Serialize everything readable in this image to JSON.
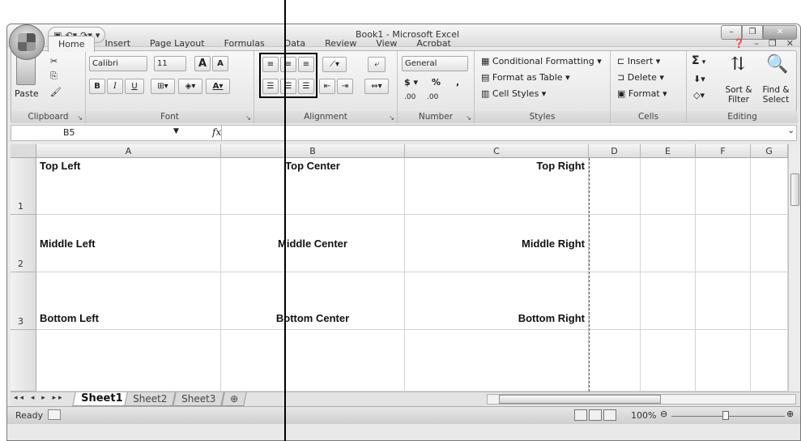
{
  "window": {
    "title": "Book1 - Microsoft Excel",
    "qat": [
      "save-icon",
      "undo-icon",
      "redo-icon",
      "customize-icon"
    ],
    "controls": [
      "minimize",
      "restore",
      "close"
    ]
  },
  "tabs": [
    "Home",
    "Insert",
    "Page Layout",
    "Formulas",
    "Data",
    "Review",
    "View",
    "Acrobat"
  ],
  "active_tab": "Home",
  "ribbon": {
    "clipboard": {
      "label": "Clipboard",
      "paste": "Paste"
    },
    "font": {
      "label": "Font",
      "name": "Calibri",
      "size": "11",
      "bold": "B",
      "italic": "I",
      "underline": "U",
      "grow": "A",
      "shrink": "A"
    },
    "alignment": {
      "label": "Alignment"
    },
    "number": {
      "label": "Number",
      "format": "General",
      "currency": "$",
      "percent": "%",
      "comma": ",",
      "inc": ".00",
      "dec": ".00"
    },
    "styles": {
      "label": "Styles",
      "conditional": "Conditional Formatting",
      "table": "Format as Table",
      "cell": "Cell Styles"
    },
    "cells": {
      "label": "Cells",
      "insert": "Insert",
      "delete": "Delete",
      "format": "Format"
    },
    "editing": {
      "label": "Editing",
      "sum": "Σ",
      "sort": "Sort & Filter",
      "find": "Find & Select"
    }
  },
  "formula_bar": {
    "name_box": "B5",
    "fx": "fx",
    "value": ""
  },
  "columns": [
    "A",
    "B",
    "C",
    "D",
    "E",
    "F",
    "G"
  ],
  "rows": [
    "1",
    "2",
    "3"
  ],
  "cells": {
    "A1": "Top Left",
    "B1": "Top Center",
    "C1": "Top Right",
    "A2": "Middle Left",
    "B2": "Middle Center",
    "C2": "Middle Right",
    "A3": "Bottom Left",
    "B3": "Bottom Center",
    "C3": "Bottom Right"
  },
  "sheets": [
    "Sheet1",
    "Sheet2",
    "Sheet3"
  ],
  "active_sheet": "Sheet1",
  "status": {
    "ready": "Ready",
    "zoom": "100%"
  }
}
